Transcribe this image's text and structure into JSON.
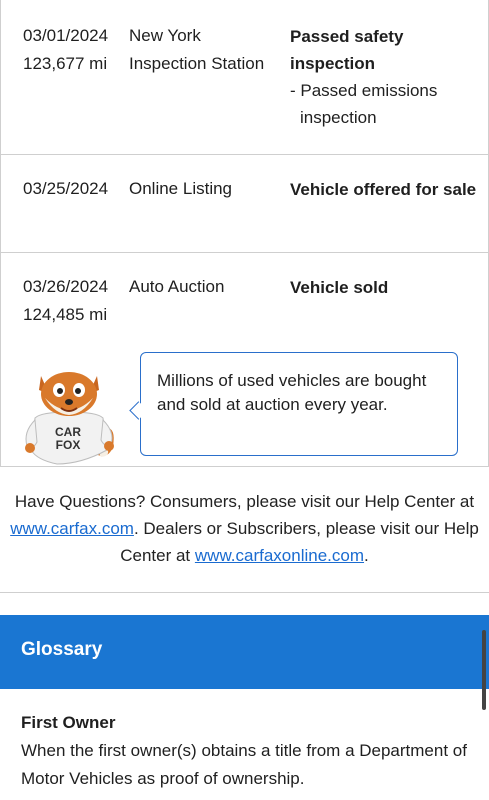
{
  "history": [
    {
      "date": "03/01/2024",
      "mileage": "123,677 mi",
      "source_line1": "New York",
      "source_line2": "Inspection Station",
      "comment_bold": "Passed safety inspection",
      "comment_sub": "- Passed emissions inspection"
    },
    {
      "date": "03/25/2024",
      "mileage": "",
      "source_line1": "Online Listing",
      "source_line2": "",
      "comment_bold": "Vehicle offered for sale",
      "comment_sub": ""
    },
    {
      "date": "03/26/2024",
      "mileage": "124,485 mi",
      "source_line1": "Auto Auction",
      "source_line2": "",
      "comment_bold": "Vehicle sold",
      "comment_sub": ""
    }
  ],
  "tip": {
    "text": "Millions of used vehicles are bought and sold at auction every year.",
    "mascot_shirt": "CAR FOX"
  },
  "help": {
    "prefix": "Have Questions? Consumers, please visit our Help Center at ",
    "link1": "www.carfax.com",
    "middle": ". Dealers or Subscribers, please visit our Help Center at ",
    "link2": "www.carfaxonline.com",
    "suffix": "."
  },
  "glossary": {
    "title": "Glossary",
    "term": "First Owner",
    "definition": "When the first owner(s) obtains a title from a Department of Motor Vehicles as proof of ownership."
  },
  "colors": {
    "accent": "#1a76d2",
    "link": "#1a6bd0",
    "bubble_border": "#2a6fcb"
  }
}
